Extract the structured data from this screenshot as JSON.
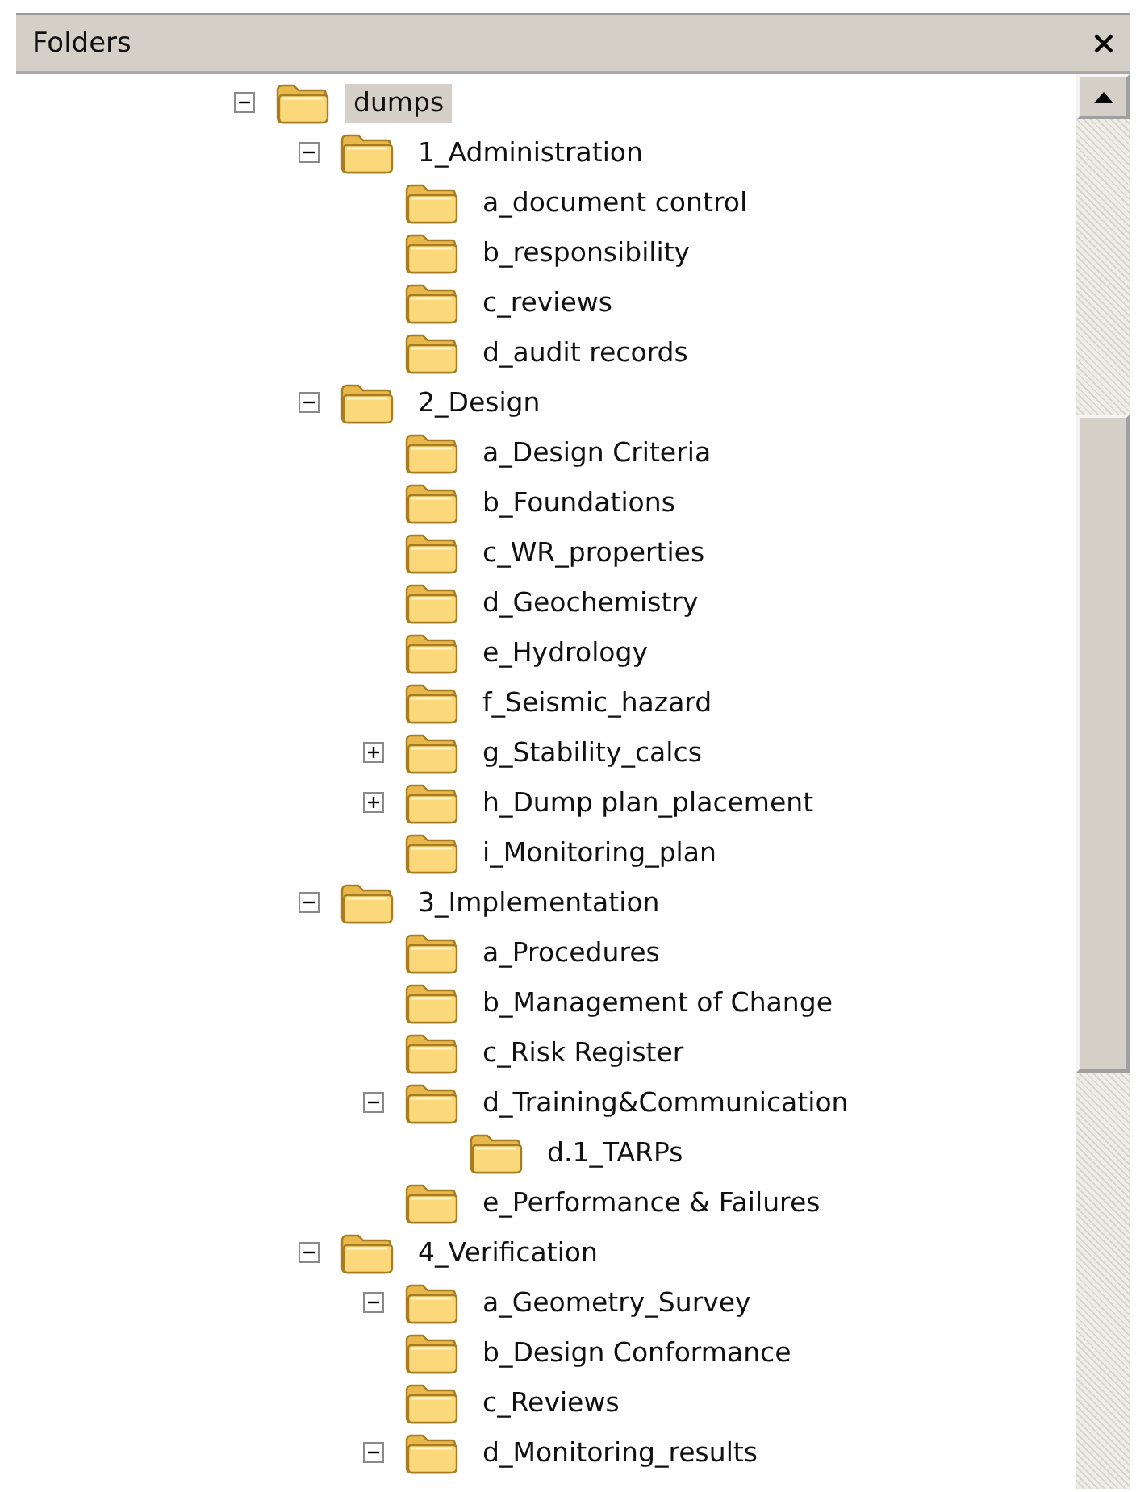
{
  "panel": {
    "title": "Folders"
  },
  "tree": [
    {
      "label": "dumps",
      "kind": "branch",
      "expanded": true,
      "selected": true,
      "children": [
        {
          "label": "1_Administration",
          "kind": "branch",
          "expanded": true,
          "selected": false,
          "children": [
            {
              "label": "a_document control",
              "kind": "leaf",
              "selected": false
            },
            {
              "label": "b_responsibility",
              "kind": "leaf",
              "selected": false
            },
            {
              "label": "c_reviews",
              "kind": "leaf",
              "selected": false
            },
            {
              "label": "d_audit records",
              "kind": "leaf",
              "selected": false
            }
          ]
        },
        {
          "label": "2_Design",
          "kind": "branch",
          "expanded": true,
          "selected": false,
          "children": [
            {
              "label": "a_Design Criteria",
              "kind": "leaf",
              "selected": false
            },
            {
              "label": "b_Foundations",
              "kind": "leaf",
              "selected": false
            },
            {
              "label": "c_WR_properties",
              "kind": "leaf",
              "selected": false
            },
            {
              "label": "d_Geochemistry",
              "kind": "leaf",
              "selected": false
            },
            {
              "label": "e_Hydrology",
              "kind": "leaf",
              "selected": false
            },
            {
              "label": "f_Seismic_hazard",
              "kind": "leaf",
              "selected": false
            },
            {
              "label": "g_Stability_calcs",
              "kind": "branch",
              "expanded": false,
              "selected": false
            },
            {
              "label": "h_Dump plan_placement",
              "kind": "branch",
              "expanded": false,
              "selected": false
            },
            {
              "label": "i_Monitoring_plan",
              "kind": "leaf",
              "selected": false
            }
          ]
        },
        {
          "label": "3_Implementation",
          "kind": "branch",
          "expanded": true,
          "selected": false,
          "children": [
            {
              "label": "a_Procedures",
              "kind": "leaf",
              "selected": false
            },
            {
              "label": "b_Management of Change",
              "kind": "leaf",
              "selected": false
            },
            {
              "label": "c_Risk Register",
              "kind": "leaf",
              "selected": false
            },
            {
              "label": "d_Training&Communication",
              "kind": "branch",
              "expanded": true,
              "selected": false,
              "children": [
                {
                  "label": "d.1_TARPs",
                  "kind": "leaf",
                  "selected": false
                }
              ]
            },
            {
              "label": "e_Performance & Failures",
              "kind": "leaf",
              "selected": false
            }
          ]
        },
        {
          "label": "4_Verification",
          "kind": "branch",
          "expanded": true,
          "selected": false,
          "children": [
            {
              "label": "a_Geometry_Survey",
              "kind": "branch",
              "expanded": true,
              "selected": false
            },
            {
              "label": "b_Design Conformance",
              "kind": "leaf",
              "selected": false
            },
            {
              "label": "c_Reviews",
              "kind": "leaf",
              "selected": false
            },
            {
              "label": "d_Monitoring_results",
              "kind": "branch",
              "expanded": true,
              "selected": false
            }
          ]
        }
      ]
    }
  ]
}
